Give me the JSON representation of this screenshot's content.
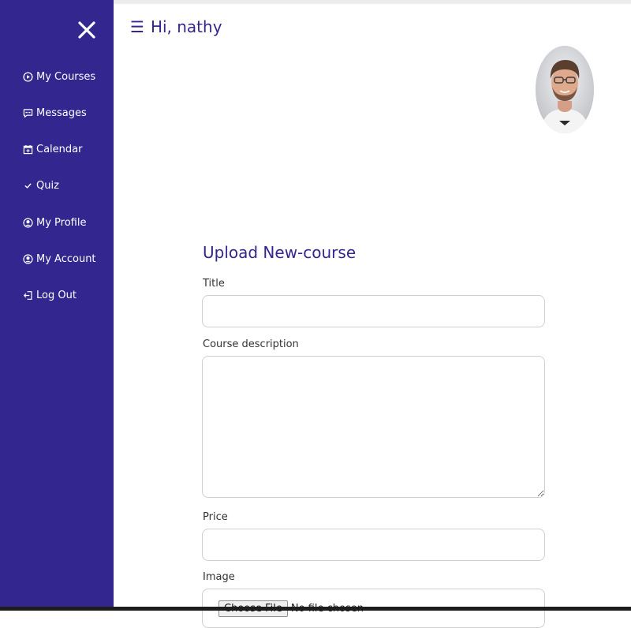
{
  "colors": {
    "sidebar_bg": "#33278f",
    "accent_text": "#33278f"
  },
  "sidebar": {
    "close_icon": "close-icon",
    "items": [
      {
        "label": "My Courses",
        "icon": "play-circle-icon"
      },
      {
        "label": "Messages",
        "icon": "chat-icon"
      },
      {
        "label": "Calendar",
        "icon": "calendar-icon"
      },
      {
        "label": "Quiz",
        "icon": "check-icon"
      },
      {
        "label": "My Profile",
        "icon": "user-circle-icon"
      },
      {
        "label": "My Account",
        "icon": "user-circle-icon"
      },
      {
        "label": "Log Out",
        "icon": "logout-icon"
      }
    ]
  },
  "header": {
    "menu_glyph": "☰",
    "greeting": "Hi, nathy"
  },
  "form": {
    "title": "Upload New-course",
    "fields": {
      "title_label": "Title",
      "title_value": "",
      "description_label": "Course description",
      "description_value": "",
      "price_label": "Price",
      "price_value": "",
      "image_label": "Image",
      "file_button": "Choose File",
      "file_status": "No file chosen"
    }
  }
}
